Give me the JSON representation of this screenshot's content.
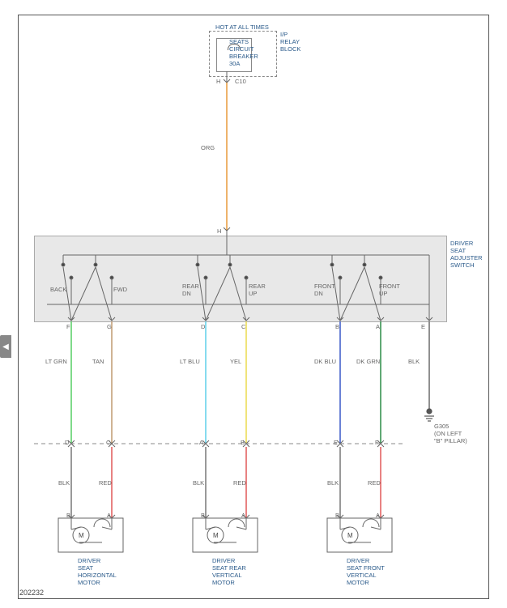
{
  "chart_data": {
    "type": "wiring-diagram",
    "source_block": {
      "title": "HOT AT ALL TIMES",
      "component": "SEATS CIRCUIT BREAKER",
      "rating": "30A",
      "container": "I/P RELAY BLOCK",
      "connector": "C10",
      "pin": "H",
      "out_wire_color": "ORG"
    },
    "switch": {
      "name": "DRIVER SEAT ADJUSTER SWITCH",
      "input_pin": "H",
      "positions": [
        "BACK",
        "FWD",
        "REAR DN",
        "REAR UP",
        "FRONT DN",
        "FRONT UP"
      ],
      "output_pins": [
        "F",
        "G",
        "D",
        "C",
        "B",
        "A",
        "E"
      ]
    },
    "wires_switch_to_connector": [
      {
        "pin": "F",
        "color": "LT GRN",
        "to_conn_pin": "D"
      },
      {
        "pin": "G",
        "color": "TAN",
        "to_conn_pin": "C"
      },
      {
        "pin": "D",
        "color": "LT BLU",
        "to_conn_pin": "A"
      },
      {
        "pin": "C",
        "color": "YEL",
        "to_conn_pin": "B"
      },
      {
        "pin": "B",
        "color": "DK BLU",
        "to_conn_pin": "E"
      },
      {
        "pin": "A",
        "color": "DK GRN",
        "to_conn_pin": "F"
      },
      {
        "pin": "E",
        "color": "BLK",
        "to": "G305",
        "note": "(ON LEFT \"B\" PILLAR)"
      }
    ],
    "motor_feeds": [
      {
        "conn_pin": "D",
        "wire": "BLK",
        "motor_pin": "B",
        "motor": "DRIVER SEAT HORIZONTAL MOTOR"
      },
      {
        "conn_pin": "C",
        "wire": "RED",
        "motor_pin": "A",
        "motor": "DRIVER SEAT HORIZONTAL MOTOR"
      },
      {
        "conn_pin": "A",
        "wire": "BLK",
        "motor_pin": "B",
        "motor": "DRIVER SEAT REAR VERTICAL MOTOR"
      },
      {
        "conn_pin": "B",
        "wire": "RED",
        "motor_pin": "A",
        "motor": "DRIVER SEAT REAR VERTICAL MOTOR"
      },
      {
        "conn_pin": "E",
        "wire": "BLK",
        "motor_pin": "B",
        "motor": "DRIVER SEAT FRONT VERTICAL MOTOR"
      },
      {
        "conn_pin": "F",
        "wire": "RED",
        "motor_pin": "A",
        "motor": "DRIVER SEAT FRONT VERTICAL MOTOR"
      }
    ],
    "motors": [
      "DRIVER SEAT HORIZONTAL MOTOR",
      "DRIVER SEAT REAR VERTICAL MOTOR",
      "DRIVER SEAT FRONT VERTICAL MOTOR"
    ]
  },
  "labels": {
    "hot": "HOT AT ALL TIMES",
    "seats": "SEATS",
    "circuit": "CIRCUIT",
    "breaker": "BREAKER",
    "rating": "30A",
    "ip": "I/P",
    "relay": "RELAY",
    "block": "BLOCK",
    "c10": "C10",
    "h": "H",
    "org": "ORG",
    "switch1": "DRIVER",
    "switch2": "SEAT",
    "switch3": "ADJUSTER",
    "switch4": "SWITCH",
    "back": "BACK",
    "fwd": "FWD",
    "reardn": "REAR\nDN",
    "rearup": "REAR\nUP",
    "frontdn": "FRONT\nDN",
    "frontup": "FRONT\nUP",
    "pinF": "F",
    "pinG": "G",
    "pinD": "D",
    "pinC": "C",
    "pinB": "B",
    "pinA": "A",
    "pinE": "E",
    "ltgrn": "LT GRN",
    "tan": "TAN",
    "ltblu": "LT BLU",
    "yel": "YEL",
    "dkblu": "DK BLU",
    "dkgrn": "DK GRN",
    "blkE": "BLK",
    "g305": "G305",
    "g305note1": "(ON LEFT",
    "g305note2": "\"B\" PILLAR)",
    "conD": "D",
    "conC": "C",
    "conA": "A",
    "conBB": "B",
    "conE": "E",
    "conF": "F",
    "blk": "BLK",
    "red": "RED",
    "mpB": "B",
    "mpA": "A",
    "m1a": "DRIVER",
    "m1b": "SEAT",
    "m1c": "HORIZONTAL",
    "m1d": "MOTOR",
    "m2a": "DRIVER",
    "m2b": "SEAT REAR",
    "m2c": "VERTICAL",
    "m2d": "MOTOR",
    "m3a": "DRIVER",
    "m3b": "SEAT FRONT",
    "m3c": "VERTICAL",
    "m3d": "MOTOR",
    "docid": "202232",
    "motorM": "M"
  }
}
